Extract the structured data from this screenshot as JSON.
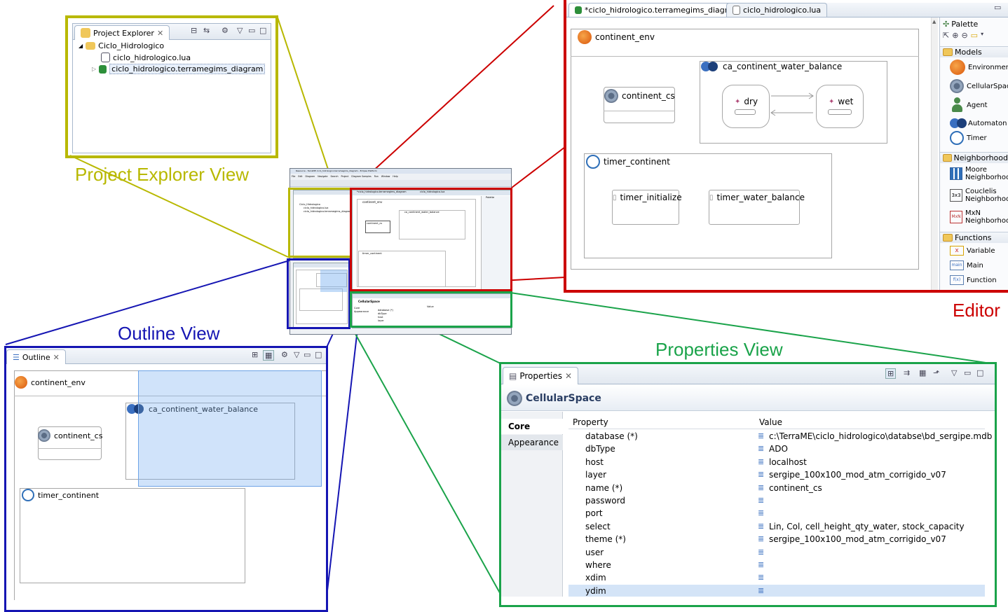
{
  "callouts": {
    "project_explorer": "Project Explorer View",
    "outline": "Outline View",
    "properties": "Properties View",
    "editor": "Editor"
  },
  "colors": {
    "project_explorer": "#b8b800",
    "outline": "#1515b3",
    "properties": "#1aa34a",
    "editor": "#cc0000"
  },
  "project_explorer": {
    "tab_title": "Project Explorer",
    "tree": {
      "project": "Ciclo_Hidrologico",
      "children": [
        "ciclo_hidrologico.lua",
        "ciclo_hidrologico.terramegims_diagram"
      ]
    }
  },
  "outline": {
    "tab_title": "Outline",
    "diagram": {
      "env": "continent_env",
      "automaton": "ca_continent_water_balance",
      "cellspace": "continent_cs",
      "timer": "timer_continent"
    }
  },
  "editor": {
    "tabs": [
      "*ciclo_hidrologico.terramegims_diagram",
      "ciclo_hidrologico.lua"
    ],
    "diagram": {
      "env": "continent_env",
      "cellspace": "continent_cs",
      "automaton": "ca_continent_water_balance",
      "states": [
        "dry",
        "wet"
      ],
      "timer": "timer_continent",
      "events": [
        "timer_initialize",
        "timer_water_balance"
      ]
    },
    "palette": {
      "title": "Palette",
      "groups": [
        {
          "name": "Models",
          "items": [
            "Environment",
            "CellularSpace",
            "Agent",
            "Automaton",
            "Timer"
          ]
        },
        {
          "name": "Neighborhood",
          "items": [
            [
              "Moore",
              "Neighborhood"
            ],
            [
              "Couclelis",
              "Neighborhood"
            ],
            [
              "MxN",
              "Neighborhood"
            ]
          ]
        },
        {
          "name": "Functions",
          "items": [
            "Variable",
            "Main",
            "Function"
          ]
        }
      ],
      "icon_labels": [
        "3x3",
        "MxN",
        "x",
        "main",
        "f(x)"
      ]
    }
  },
  "properties": {
    "tab_title": "Properties",
    "heading": "CellularSpace",
    "sections": [
      "Core",
      "Appearance"
    ],
    "columns": [
      "Property",
      "Value"
    ],
    "rows": [
      [
        "database (*)",
        "c:\\TerraME\\ciclo_hidrologico\\databse\\bd_sergipe.mdb"
      ],
      [
        "dbType",
        "ADO"
      ],
      [
        "host",
        "localhost"
      ],
      [
        "layer",
        "sergipe_100x100_mod_atm_corrigido_v07"
      ],
      [
        "name (*)",
        "continent_cs"
      ],
      [
        "password",
        ""
      ],
      [
        "port",
        ""
      ],
      [
        "select",
        "Lin, Col, cell_height_qty_water, stock_capacity"
      ],
      [
        "theme (*)",
        "sergipe_100x100_mod_atm_corrigido_v07"
      ],
      [
        "user",
        ""
      ],
      [
        "where",
        ""
      ],
      [
        "xdim",
        ""
      ],
      [
        "ydim",
        ""
      ]
    ]
  },
  "mini_window": {
    "title": "Resource - TerraME ciclo_hidrologico.terramegims_diagram - Eclipse Platform",
    "menu": [
      "File",
      "Edit",
      "Diagram",
      "Navigate",
      "Search",
      "Project",
      "Diagram Samples",
      "Run",
      "Window",
      "Help"
    ]
  }
}
